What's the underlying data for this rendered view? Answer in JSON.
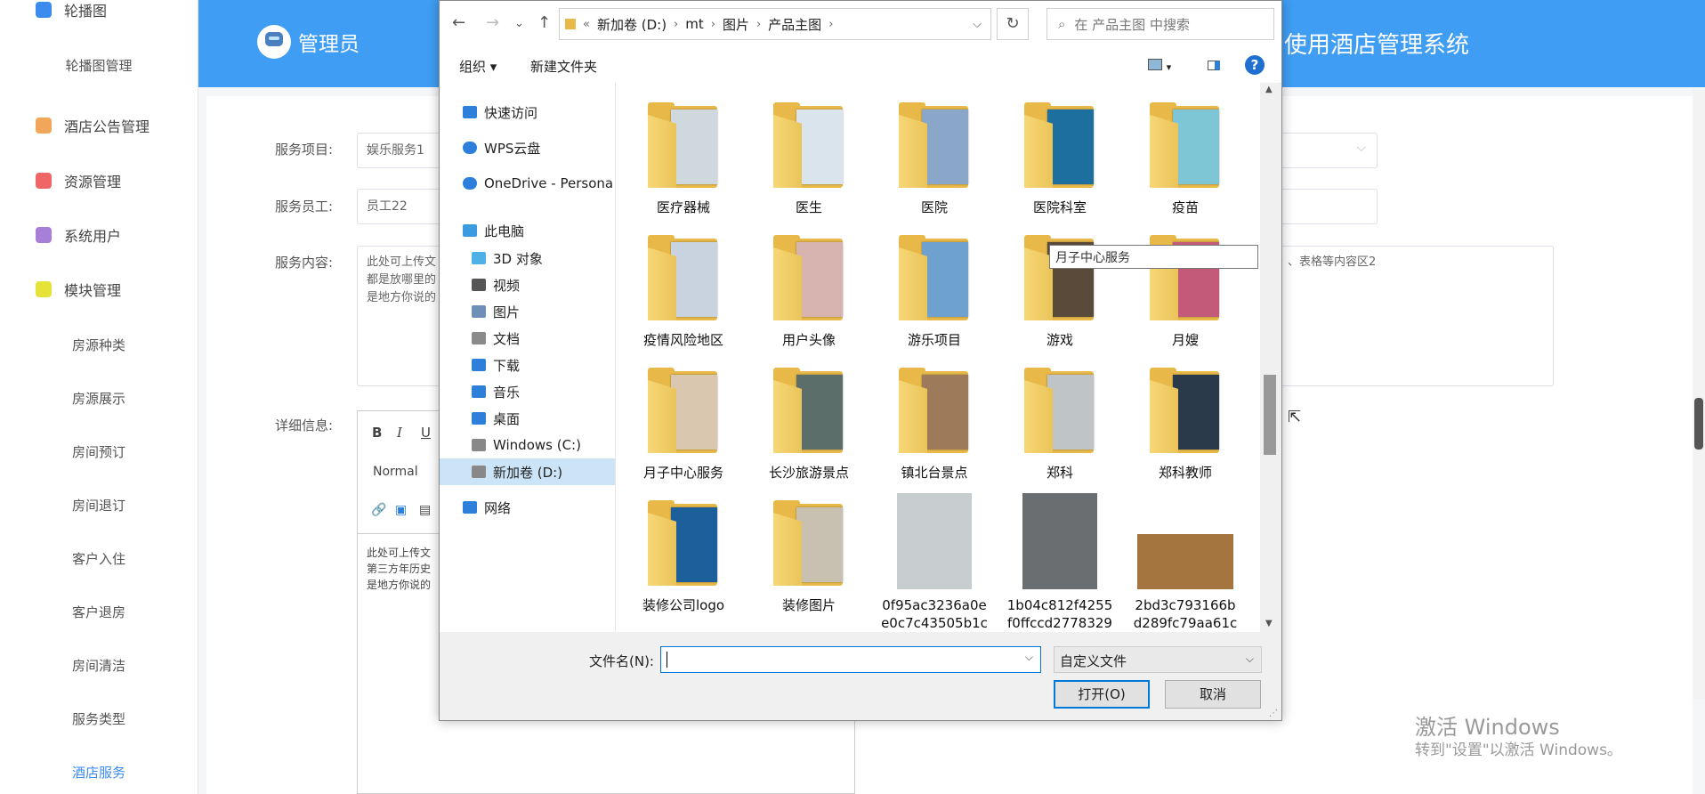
{
  "sidebar": {
    "items": [
      {
        "label": "轮播图",
        "type": "top",
        "icon": "star-icon",
        "color": "#3c8cf0"
      },
      {
        "label": "轮播图管理",
        "type": "sub"
      },
      {
        "label": "酒店公告管理",
        "type": "top",
        "icon": "gear-icon",
        "color": "#f2a65a"
      },
      {
        "label": "资源管理",
        "type": "top",
        "icon": "grid-icon",
        "color": "#ef6666"
      },
      {
        "label": "系统用户",
        "type": "top",
        "icon": "box-icon",
        "color": "#a77fd6"
      },
      {
        "label": "模块管理",
        "type": "top",
        "icon": "cube-icon",
        "color": "#e6e23a"
      },
      {
        "label": "房源种类",
        "type": "sub"
      },
      {
        "label": "房源展示",
        "type": "sub"
      },
      {
        "label": "房间预订",
        "type": "sub"
      },
      {
        "label": "房间退订",
        "type": "sub"
      },
      {
        "label": "客户入住",
        "type": "sub"
      },
      {
        "label": "客户退房",
        "type": "sub"
      },
      {
        "label": "房间清洁",
        "type": "sub"
      },
      {
        "label": "服务类型",
        "type": "sub"
      },
      {
        "label": "酒店服务",
        "type": "sub",
        "active": true
      }
    ]
  },
  "header": {
    "admin": "管理员",
    "title": "使用酒店管理系统",
    "color": "#3f9df3"
  },
  "form": {
    "service_item_label": "服务项目:",
    "service_item_value": "娱乐服务1",
    "staff_label": "服务员工:",
    "staff_value": "员工22",
    "content_label": "服务内容:",
    "content_text_left": "此处可上传文\n都是放哪里的\n是地方你说的",
    "content_text_right": "、表格等内容区2",
    "detail_label": "详细信息:",
    "editor_bold": "B",
    "editor_italic": "I",
    "editor_underline": "U",
    "editor_format": "Normal",
    "editor_content": "此处可上传文\n第三方年历史\n是地方你说的"
  },
  "dialog": {
    "breadcrumb": [
      "新加卷 (D:)",
      "mt",
      "图片",
      "产品主图"
    ],
    "search_placeholder": "在 产品主图 中搜索",
    "organize": "组织 ▾",
    "new_folder": "新建文件夹",
    "help": "?",
    "nav": [
      {
        "label": "快速访问",
        "icon": "star-icon",
        "color": "#2d7fd9"
      },
      {
        "label": "WPS云盘",
        "icon": "cloud-icon",
        "color": "#2d7fd9"
      },
      {
        "label": "OneDrive - Persona",
        "icon": "onedrive-icon",
        "color": "#2d7fd9"
      },
      {
        "label": "此电脑",
        "icon": "computer-icon",
        "color": "#3a9be0"
      },
      {
        "label": "3D 对象",
        "icon": "cube-icon",
        "color": "#4fb0e6"
      },
      {
        "label": "视频",
        "icon": "video-icon",
        "color": "#555"
      },
      {
        "label": "图片",
        "icon": "picture-icon",
        "color": "#6d8fb8"
      },
      {
        "label": "文档",
        "icon": "document-icon",
        "color": "#8a8a8a"
      },
      {
        "label": "下载",
        "icon": "download-icon",
        "color": "#2d7fd9"
      },
      {
        "label": "音乐",
        "icon": "music-icon",
        "color": "#2d7fd9"
      },
      {
        "label": "桌面",
        "icon": "desktop-icon",
        "color": "#2d7fd9"
      },
      {
        "label": "Windows (C:)",
        "icon": "drive-icon",
        "color": "#888"
      },
      {
        "label": "新加卷 (D:)",
        "icon": "drive-icon",
        "color": "#888",
        "selected": true
      },
      {
        "label": "网络",
        "icon": "network-icon",
        "color": "#2d7fd9"
      }
    ],
    "items": [
      {
        "label": "医疗器械",
        "kind": "folder",
        "color": "#cfd8dc"
      },
      {
        "label": "医生",
        "kind": "folder",
        "color": "#d9e4ec"
      },
      {
        "label": "医院",
        "kind": "folder",
        "color": "#8aa7c9"
      },
      {
        "label": "医院科室",
        "kind": "folder",
        "color": "#1d6f9f"
      },
      {
        "label": "疫苗",
        "kind": "folder",
        "color": "#7ec6d6"
      },
      {
        "label": "疫情风险地区",
        "kind": "folder",
        "color": "#c9d3e0"
      },
      {
        "label": "用户头像",
        "kind": "folder",
        "color": "#d8b4b0"
      },
      {
        "label": "游乐项目",
        "kind": "folder",
        "color": "#6fa1cf"
      },
      {
        "label": "游戏",
        "kind": "folder",
        "color": "#5a4a3a"
      },
      {
        "label": "月嫂",
        "kind": "folder",
        "color": "#c45a7a"
      },
      {
        "label": "月子中心服务",
        "kind": "folder",
        "color": "#d9c7b0"
      },
      {
        "label": "长沙旅游景点",
        "kind": "folder",
        "color": "#5c6e6a"
      },
      {
        "label": "镇北台景点",
        "kind": "folder",
        "color": "#9c7a5a"
      },
      {
        "label": "郑科",
        "kind": "folder",
        "color": "#bfc4c6"
      },
      {
        "label": "郑科教师",
        "kind": "folder",
        "color": "#2a3a4a"
      },
      {
        "label": "装修公司logo",
        "kind": "folder",
        "color": "#1d5f9a"
      },
      {
        "label": "装修图片",
        "kind": "folder",
        "color": "#c8c0b0"
      },
      {
        "label": "0f95ac3236a0e\ne0c7c43505b1c",
        "kind": "image",
        "color": "#c8cdd0"
      },
      {
        "label": "1b04c812f4255\nf0ffccd2778329",
        "kind": "image",
        "color": "#6b6e70"
      },
      {
        "label": "2bd3c793166b\nd289fc79aa61c",
        "kind": "image",
        "color": "#a5753f"
      }
    ],
    "tooltip": "月子中心服务",
    "filename_label": "文件名(N):",
    "filename_value": "",
    "filetype": "自定义文件",
    "open": "打开(O)",
    "cancel": "取消"
  },
  "watermark": {
    "line1": "激活 Windows",
    "line2": "转到\"设置\"以激活 Windows。"
  }
}
